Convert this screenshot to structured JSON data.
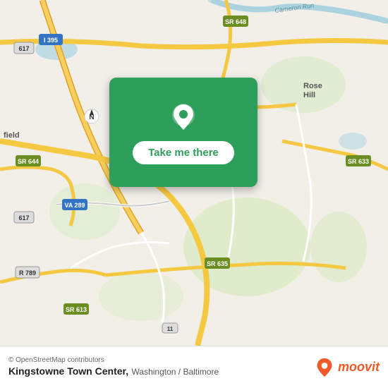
{
  "map": {
    "background_color": "#f2efe9",
    "center_lat": 38.8,
    "center_lng": -77.1
  },
  "card": {
    "button_label": "Take me there",
    "background_color": "#2e9e5b"
  },
  "bottom_bar": {
    "osm_credit": "© OpenStreetMap contributors",
    "location_name": "Kingstowne Town Center,",
    "location_region": "Washington / Baltimore",
    "moovit_text": "moovit"
  },
  "road_labels": {
    "i395": "I 395",
    "sr648": "SR 648",
    "sr613_top": "SR 613",
    "sr644": "SR 644",
    "sr633": "SR 633",
    "sr613_bot": "SR 613",
    "sr635": "SR 635",
    "va289": "VA 289",
    "r789": "R 789",
    "r617_top": "617",
    "r617_bot": "617",
    "cameron_run": "Cameron Run"
  }
}
